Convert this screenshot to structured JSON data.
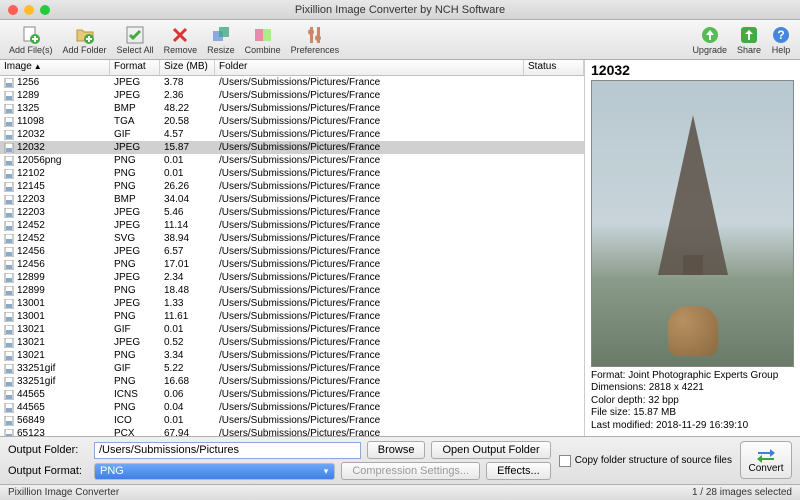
{
  "window": {
    "title": "Pixillion Image Converter by NCH Software"
  },
  "toolbar": {
    "left": [
      {
        "id": "add-files",
        "label": "Add File(s)"
      },
      {
        "id": "add-folder",
        "label": "Add Folder"
      },
      {
        "id": "select-all",
        "label": "Select All"
      },
      {
        "id": "remove",
        "label": "Remove"
      },
      {
        "id": "resize",
        "label": "Resize"
      },
      {
        "id": "combine",
        "label": "Combine"
      },
      {
        "id": "preferences",
        "label": "Preferences"
      }
    ],
    "right": [
      {
        "id": "upgrade",
        "label": "Upgrade"
      },
      {
        "id": "share",
        "label": "Share"
      },
      {
        "id": "help",
        "label": "Help"
      }
    ]
  },
  "columns": {
    "image": "Image",
    "format": "Format",
    "size": "Size (MB)",
    "folder": "Folder",
    "status": "Status"
  },
  "folder_path": "/Users/Submissions/Pictures/France",
  "files": [
    {
      "name": "1256",
      "format": "JPEG",
      "size": "3.78"
    },
    {
      "name": "1289",
      "format": "JPEG",
      "size": "2.36"
    },
    {
      "name": "1325",
      "format": "BMP",
      "size": "48.22"
    },
    {
      "name": "11098",
      "format": "TGA",
      "size": "20.58"
    },
    {
      "name": "12032",
      "format": "GIF",
      "size": "4.57"
    },
    {
      "name": "12032",
      "format": "JPEG",
      "size": "15.87",
      "selected": true
    },
    {
      "name": "12056png",
      "format": "PNG",
      "size": "0.01"
    },
    {
      "name": "12102",
      "format": "PNG",
      "size": "0.01"
    },
    {
      "name": "12145",
      "format": "PNG",
      "size": "26.26"
    },
    {
      "name": "12203",
      "format": "BMP",
      "size": "34.04"
    },
    {
      "name": "12203",
      "format": "JPEG",
      "size": "5.46"
    },
    {
      "name": "12452",
      "format": "JPEG",
      "size": "11.14"
    },
    {
      "name": "12452",
      "format": "SVG",
      "size": "38.94"
    },
    {
      "name": "12456",
      "format": "JPEG",
      "size": "6.57"
    },
    {
      "name": "12456",
      "format": "PNG",
      "size": "17.01"
    },
    {
      "name": "12899",
      "format": "JPEG",
      "size": "2.34"
    },
    {
      "name": "12899",
      "format": "PNG",
      "size": "18.48"
    },
    {
      "name": "13001",
      "format": "JPEG",
      "size": "1.33"
    },
    {
      "name": "13001",
      "format": "PNG",
      "size": "11.61"
    },
    {
      "name": "13021",
      "format": "GIF",
      "size": "0.01"
    },
    {
      "name": "13021",
      "format": "JPEG",
      "size": "0.52"
    },
    {
      "name": "13021",
      "format": "PNG",
      "size": "3.34"
    },
    {
      "name": "33251gif",
      "format": "GIF",
      "size": "5.22"
    },
    {
      "name": "33251gif",
      "format": "PNG",
      "size": "16.68"
    },
    {
      "name": "44565",
      "format": "ICNS",
      "size": "0.06"
    },
    {
      "name": "44565",
      "format": "PNG",
      "size": "0.04"
    },
    {
      "name": "56849",
      "format": "ICO",
      "size": "0.01"
    },
    {
      "name": "65123",
      "format": "PCX",
      "size": "67.94"
    }
  ],
  "preview": {
    "title": "12032",
    "meta": {
      "format": "Format: Joint Photographic Experts Group",
      "dims": "Dimensions: 2818 x 4221",
      "depth": "Color depth: 32 bpp",
      "filesize": "File size: 15.87 MB",
      "modified": "Last modified: 2018-11-29 16:39:10"
    }
  },
  "output": {
    "folder_label": "Output Folder:",
    "folder_value": "/Users/Submissions/Pictures",
    "format_label": "Output Format:",
    "format_value": "PNG",
    "browse": "Browse",
    "open": "Open Output Folder",
    "compression": "Compression Settings...",
    "effects": "Effects...",
    "copy_structure": "Copy folder structure of source files",
    "convert": "Convert"
  },
  "status": {
    "left": "Pixillion Image Converter",
    "right": "1 / 28 images selected"
  }
}
